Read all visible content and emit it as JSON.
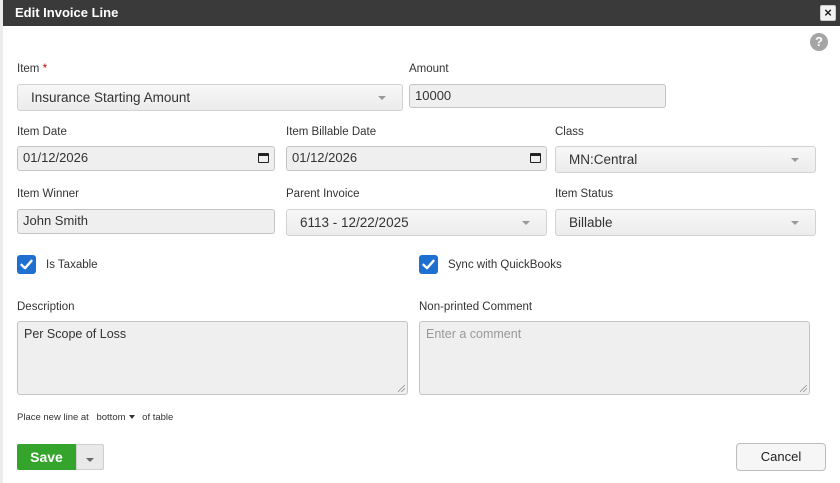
{
  "dialog": {
    "title": "Edit Invoice Line",
    "close_glyph": "×",
    "help_glyph": "?"
  },
  "form": {
    "item": {
      "label": "Item",
      "required_mark": "*",
      "value": "Insurance Starting Amount"
    },
    "amount": {
      "label": "Amount",
      "value": "10000"
    },
    "item_date": {
      "label": "Item Date",
      "value": "01/12/2026"
    },
    "item_billable_date": {
      "label": "Item Billable Date",
      "value": "01/12/2026"
    },
    "class": {
      "label": "Class",
      "value": "MN:Central"
    },
    "item_winner": {
      "label": "Item Winner",
      "value": "John Smith"
    },
    "parent_invoice": {
      "label": "Parent Invoice",
      "value": "6113 - 12/22/2025"
    },
    "item_status": {
      "label": "Item Status",
      "value": "Billable"
    },
    "is_taxable": {
      "label": "Is Taxable",
      "checked": true
    },
    "sync_quickbooks": {
      "label": "Sync with QuickBooks",
      "checked": true
    },
    "description": {
      "label": "Description",
      "value": "Per Scope of Loss"
    },
    "comment": {
      "label": "Non-printed Comment",
      "placeholder": "Enter a comment"
    }
  },
  "new_line": {
    "prefix": "Place new line at",
    "position": "bottom",
    "suffix": "of table"
  },
  "buttons": {
    "save": "Save",
    "cancel": "Cancel"
  },
  "colors": {
    "titlebar": "#3a3a3a",
    "save": "#34a42c",
    "checkbox": "#1f6fd1",
    "required": "#cc0000"
  }
}
